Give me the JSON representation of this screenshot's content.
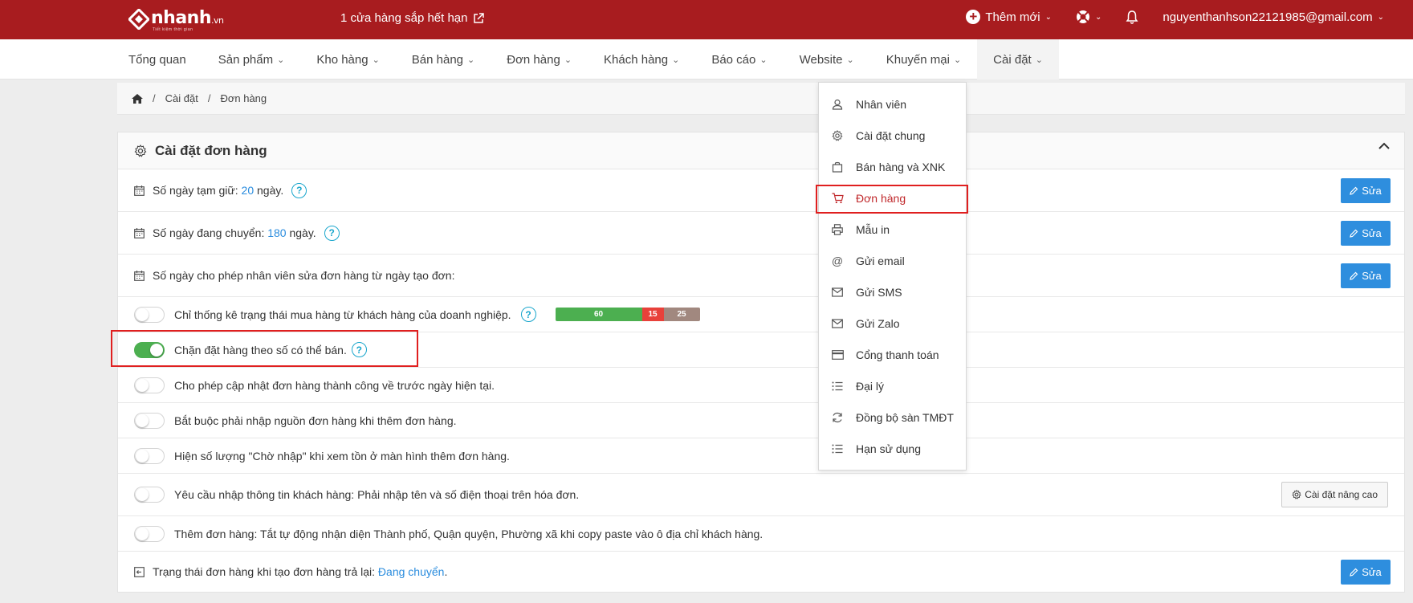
{
  "topbar": {
    "logo_text": "nhanh",
    "logo_suffix": ".vn",
    "logo_tagline": "Tiết kiệm thời gian",
    "low_stock": "1 cửa hàng sắp hết hạn",
    "add_new": "Thêm mới",
    "user_email": "nguyenthanhson22121985@gmail.com"
  },
  "nav": {
    "items": [
      "Tổng quan",
      "Sản phẩm",
      "Kho hàng",
      "Bán hàng",
      "Đơn hàng",
      "Khách hàng",
      "Báo cáo",
      "Website",
      "Khuyến mại",
      "Cài đặt"
    ]
  },
  "breadcrumb": [
    "Cài đặt",
    "Đơn hàng"
  ],
  "panel": {
    "title": "Cài đặt đơn hàng",
    "edit_label": "Sửa",
    "advanced_label": "Cài đặt nâng cao",
    "rows": {
      "hold_days_prefix": "Số ngày tạm giữ:",
      "hold_days_value": "20",
      "hold_days_suffix": "ngày.",
      "shipping_days_prefix": "Số ngày đang chuyển:",
      "shipping_days_value": "180",
      "shipping_days_suffix": "ngày.",
      "edit_days": "Số ngày cho phép nhân viên sửa đơn hàng từ ngày tạo đơn:",
      "stat_status": "Chỉ thống kê trạng thái mua hàng từ khách hàng của doanh nghiệp.",
      "block_order": "Chặn đặt hàng theo số có thể bán.",
      "allow_update": "Cho phép cập nhật đơn hàng thành công về trước ngày hiện tại.",
      "require_source": "Bắt buộc phải nhập nguồn đơn hàng khi thêm đơn hàng.",
      "show_pending": "Hiện số lượng \"Chờ nhập\" khi xem tồn ở màn hình thêm đơn hàng.",
      "require_customer": "Yêu cầu nhập thông tin khách hàng: Phải nhập tên và số điện thoại trên hóa đơn.",
      "auto_detect": "Thêm đơn hàng: Tắt tự động nhận diện Thành phố, Quận quyện, Phường xã khi copy paste vào ô địa chỉ khách hàng.",
      "return_status_prefix": "Trạng thái đơn hàng khi tạo đơn hàng trả lại:",
      "return_status_value": "Đang chuyển"
    },
    "progress": [
      {
        "label": "60",
        "value": 60,
        "color": "#4caf50"
      },
      {
        "label": "15",
        "value": 15,
        "color": "#e8413a"
      },
      {
        "label": "25",
        "value": 25,
        "color": "#a1887f"
      }
    ],
    "toggles": {
      "stat_status": false,
      "block_order": true,
      "allow_update": false,
      "require_source": false,
      "show_pending": false,
      "require_customer": false,
      "auto_detect": false
    }
  },
  "dropdown": {
    "items": [
      {
        "label": "Nhân viên",
        "icon": "user-icon"
      },
      {
        "label": "Cài đặt chung",
        "icon": "gear-icon"
      },
      {
        "label": "Bán hàng và XNK",
        "icon": "bag-icon"
      },
      {
        "label": "Đơn hàng",
        "icon": "cart-icon"
      },
      {
        "label": "Mẫu in",
        "icon": "printer-icon"
      },
      {
        "label": "Gửi email",
        "icon": "at-icon"
      },
      {
        "label": "Gửi SMS",
        "icon": "envelope-icon"
      },
      {
        "label": "Gửi Zalo",
        "icon": "envelope-icon"
      },
      {
        "label": "Cổng thanh toán",
        "icon": "credit-card-icon"
      },
      {
        "label": "Đại lý",
        "icon": "list-icon"
      },
      {
        "label": "Đồng bộ sàn TMĐT",
        "icon": "sync-icon"
      },
      {
        "label": "Hạn sử dụng",
        "icon": "list-icon"
      }
    ],
    "selected": "Đơn hàng"
  },
  "colors": {
    "brand": "#a81c1f",
    "link": "#2a8cde",
    "button": "#2e8ede",
    "toggle_on": "#4caf50",
    "highlight": "#e01f1f"
  }
}
